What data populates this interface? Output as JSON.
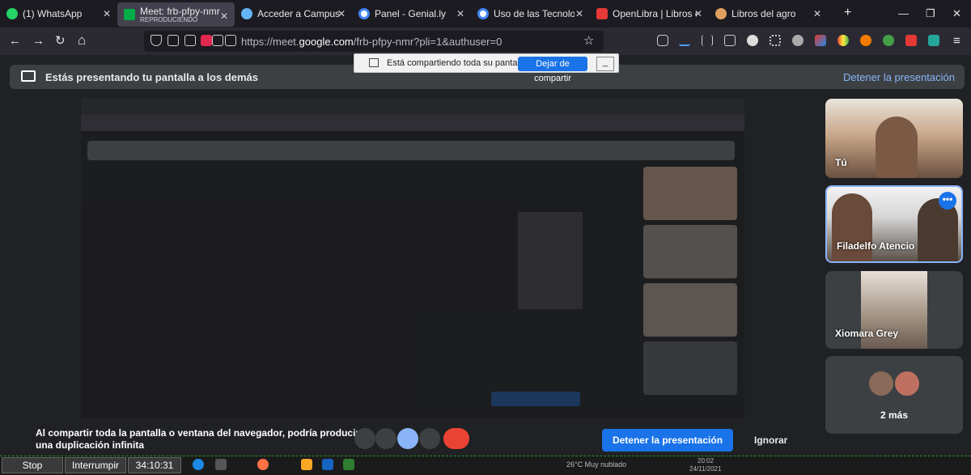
{
  "tabs": [
    {
      "label": "(1) WhatsApp",
      "color": "#25d366",
      "icon": "whatsapp-icon"
    },
    {
      "label": "Meet: frb-pfpy-nmr",
      "sub": "REPRODUCIENDO",
      "color": "#00ac47",
      "icon": "meet-icon"
    },
    {
      "label": "Acceder a Campus Virtu",
      "color": "#64b5f6",
      "icon": "campus-icon"
    },
    {
      "label": "Panel - Genial.ly",
      "color": "#ffffff",
      "icon": "google-icon"
    },
    {
      "label": "Uso de las Tecnologías e",
      "color": "#ffffff",
      "icon": "google-icon"
    },
    {
      "label": "OpenLibra | Libros en la",
      "color": "#e53935",
      "icon": "openlibra-icon"
    },
    {
      "label": "Libros del agro",
      "color": "#e0a060",
      "icon": "book-icon"
    }
  ],
  "window": {
    "minimize": "—",
    "maximize": "❐",
    "close": "✕",
    "new_tab": "+"
  },
  "nav": {
    "back": "←",
    "forward": "→",
    "reload": "↻",
    "home": "⌂",
    "url_prefix": "https://meet.",
    "url_domain": "google.com",
    "url_suffix": "/frb-pfpy-nmr?pli=1&authuser=0",
    "star": "☆"
  },
  "share_notice": {
    "text": "Está compartiendo toda su pantalla.",
    "stop": "Dejar de compartir",
    "minimize": "_"
  },
  "presenting": {
    "text": "Estás presentando tu pantalla a los demás",
    "stop": "Detener la presentación"
  },
  "participants": [
    {
      "name": "Tú",
      "bg": "#b48a6a"
    },
    {
      "name": "Filadelfo Atencio",
      "bg": "#6b6660",
      "more": "•••"
    },
    {
      "name": "Xiomara Grey",
      "bg": "#8a7b72"
    }
  ],
  "others": {
    "label": "2 más"
  },
  "warning": "Al compartir toda la pantalla o ventana del navegador, podría producirse una duplicación infinita",
  "actions": {
    "stop_presenting": "Detener la presentación",
    "ignore": "Ignorar"
  },
  "recorder": {
    "stop": "Stop",
    "pause": "Interrumpir",
    "time": "34:10:31"
  },
  "tray": {
    "weather": "26°C  Muy nublado",
    "time": "20:02",
    "date": "24/11/2021"
  }
}
